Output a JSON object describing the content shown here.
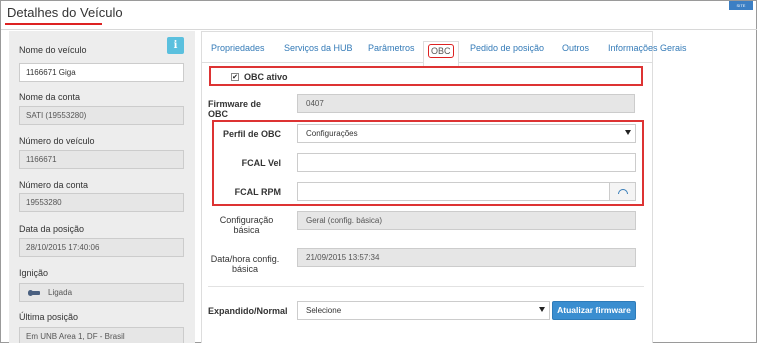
{
  "window": {
    "title": "Detalhes do Veículo",
    "corner_logo": "SITE"
  },
  "left": {
    "info_button": "i",
    "fields": [
      {
        "label": "Nome do veículo",
        "value": "1166671 Giga"
      },
      {
        "label": "Nome da conta",
        "value": "SATI (19553280)"
      },
      {
        "label": "Número do veículo",
        "value": "1166671"
      },
      {
        "label": "Número da conta",
        "value": "19553280"
      },
      {
        "label": "Data da posição",
        "value": "28/10/2015 17:40:06"
      },
      {
        "label": "Ignição",
        "value": "Ligada"
      },
      {
        "label": "Última posição",
        "value": "Em  UNB Area 1, DF - Brasil"
      }
    ]
  },
  "tabs": [
    {
      "label": "Propriedades"
    },
    {
      "label": "Serviços da HUB"
    },
    {
      "label": "Parâmetros"
    },
    {
      "label": "OBC"
    },
    {
      "label": "Pedido de posição"
    },
    {
      "label": "Outros"
    },
    {
      "label": "Informações Gerais"
    }
  ],
  "obc": {
    "active_label": "OBC ativo",
    "active_checked": "✔",
    "firmware_label": "Firmware de OBC",
    "firmware_value": "0407",
    "profile_label": "Perfil de OBC",
    "profile_value": "Configurações",
    "fcal_vel_label": "FCAL Vel",
    "fcal_vel_value": "",
    "fcal_rpm_label": "FCAL RPM",
    "fcal_rpm_value": "",
    "basic_config_label_1": "Configuração",
    "basic_config_label_2": "básica",
    "basic_config_value": "Geral (config. básica)",
    "datetime_label_1": "Data/hora config.",
    "datetime_label_2": "básica",
    "datetime_value": "21/09/2015 13:57:34",
    "expand_label": "Expandido/Normal",
    "expand_value": "Selecione",
    "update_button": "Atualizar firmware"
  }
}
